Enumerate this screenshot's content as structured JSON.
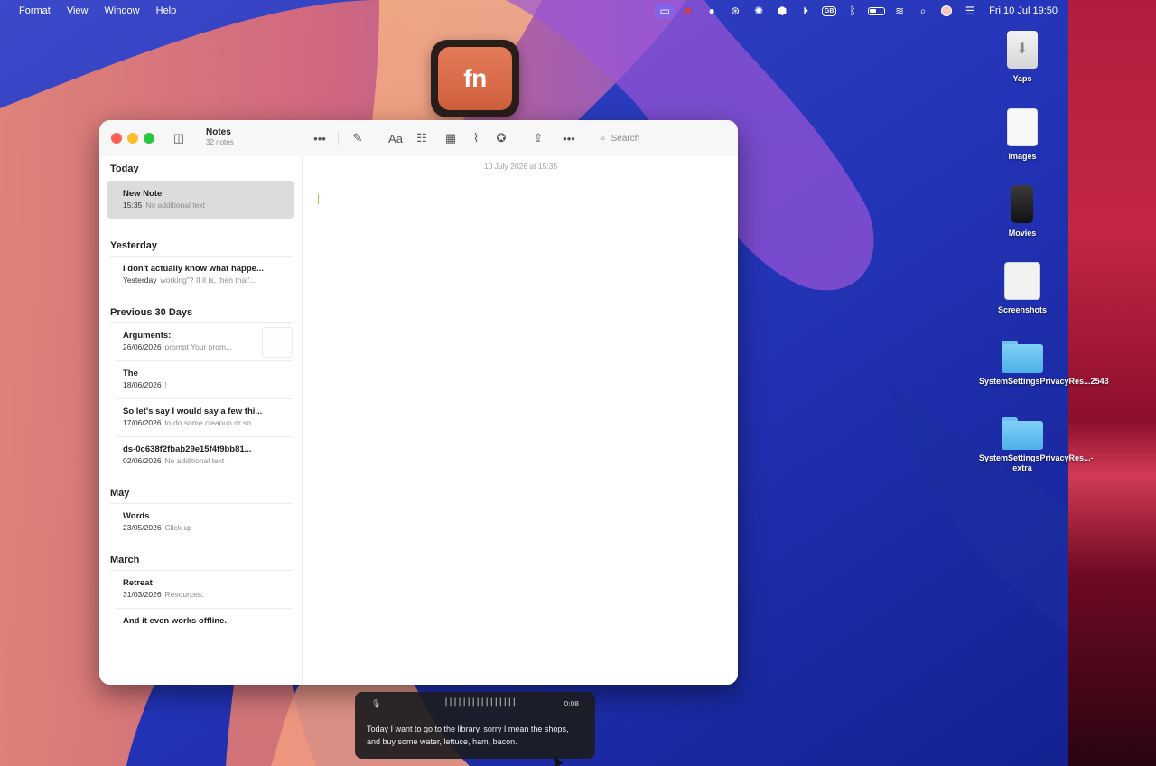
{
  "menubar": {
    "items": [
      "Format",
      "View",
      "Window",
      "Help"
    ],
    "clock": "Fri 10 Jul  19:50",
    "input_source": "GB"
  },
  "overlay": {
    "fn_key_label": "fn"
  },
  "notes_app": {
    "window_title": "Notes",
    "note_count": "32 notes",
    "search_placeholder": "Search",
    "editor_timestamp": "10 July 2026 at 15:35",
    "sections": [
      {
        "heading": "Today",
        "notes": [
          {
            "title": "New Note",
            "date": "15:35",
            "preview": "No additional text",
            "selected": true
          }
        ]
      },
      {
        "heading": "Yesterday",
        "notes": [
          {
            "title": "I don't actually know what happe...",
            "date": "Yesterday",
            "preview": "working\"? If it is, then that'..."
          }
        ]
      },
      {
        "heading": "Previous 30 Days",
        "notes": [
          {
            "title": "Arguments:",
            "date": "26/06/2026",
            "preview": "prompt Your prom...",
            "has_thumbnail": true
          },
          {
            "title": "The",
            "date": "18/06/2026",
            "preview": "!"
          },
          {
            "title": "So let's say I would say a few thi...",
            "date": "17/06/2026",
            "preview": "to do some cleanup or so..."
          },
          {
            "title": "ds-0c638f2fbab29e15f4f9bb81...",
            "date": "02/06/2026",
            "preview": "No additional text"
          }
        ]
      },
      {
        "heading": "May",
        "notes": [
          {
            "title": "Words",
            "date": "23/05/2026",
            "preview": "Click up"
          }
        ]
      },
      {
        "heading": "March",
        "notes": [
          {
            "title": "Retreat",
            "date": "31/03/2026",
            "preview": "Resources:"
          },
          {
            "title": "And it even works offline.",
            "date": "",
            "preview": ""
          }
        ]
      }
    ]
  },
  "desktop_icons": [
    {
      "label": "Yaps",
      "icon": "download-file-icon"
    },
    {
      "label": "Images",
      "icon": "document-icon"
    },
    {
      "label": "Movies",
      "icon": "phone-file-icon"
    },
    {
      "label": "Screenshots",
      "icon": "screenshot-stack-icon"
    },
    {
      "label": "SystemSettingsPrivacyRes...2543",
      "icon": "folder-icon"
    },
    {
      "label": "SystemSettingsPrivacyRes...-extra",
      "icon": "folder-icon"
    }
  ],
  "dictation": {
    "waveform": "||||||||||||||||",
    "elapsed": "0:08",
    "transcript": "Today I want to go to the library, sorry I mean the shops, and buy some water, lettuce, ham, bacon."
  }
}
